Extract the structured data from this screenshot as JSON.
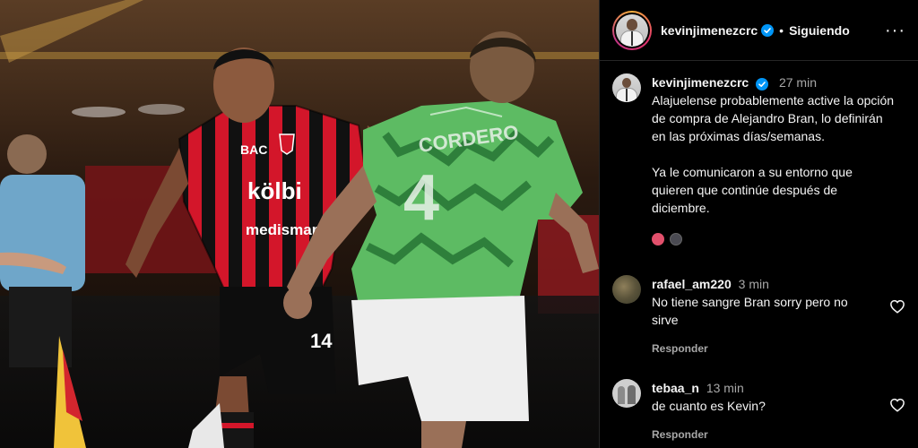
{
  "post": {
    "username": "kevinjimenezcrc",
    "follow_status": "Siguiendo",
    "separator": "•",
    "more_label": "···"
  },
  "caption": {
    "username": "kevinjimenezcrc",
    "time": "27 min",
    "text": "Alajuelense probablemente active la opción de compra de Alejandro Bran, lo definirán en las próximas días/semanas.\n\nYa le comunicaron a su entorno que quieren que continúe después de diciembre."
  },
  "comments": [
    {
      "username": "rafael_am220",
      "time": "3 min",
      "text": "No tiene sangre Bran sorry pero no sirve",
      "reply_label": "Responder"
    },
    {
      "username": "tebaa_n",
      "time": "13 min",
      "text": "de cuanto es Kevin?",
      "reply_label": "Responder"
    }
  ],
  "photo": {
    "jersey_sponsors": [
      "BAC",
      "kölbi",
      "medismart"
    ],
    "player_number": "14",
    "opponent_name": "CORDERO",
    "opponent_number": "4"
  },
  "colors": {
    "verified": "#0095f6",
    "muted_text": "#a8a8a8",
    "jersey_red": "#d3162a",
    "jersey_green": "#5dbb63"
  }
}
